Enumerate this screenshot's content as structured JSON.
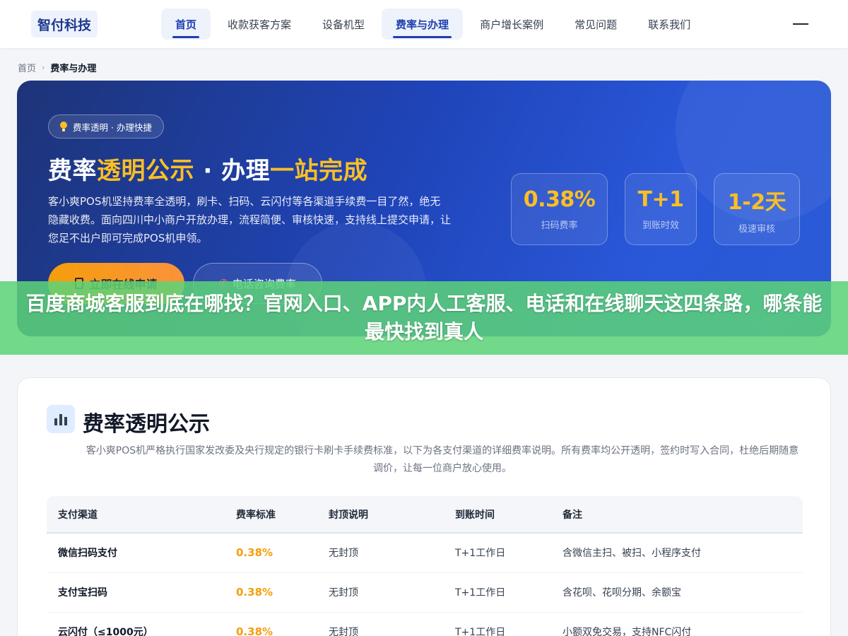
{
  "header": {
    "logo": "智付科技",
    "nav": [
      {
        "label": "首页",
        "active": true
      },
      {
        "label": "收款获客方案",
        "active": false
      },
      {
        "label": "设备机型",
        "active": false
      },
      {
        "label": "费率与办理",
        "active": true
      },
      {
        "label": "商户增长案例",
        "active": false
      },
      {
        "label": "常见问题",
        "active": false
      },
      {
        "label": "联系我们",
        "active": false
      }
    ]
  },
  "breadcrumb": {
    "home": "首页",
    "separator": "›",
    "current": "费率与办理"
  },
  "hero": {
    "badge": "费率透明 · 办理快捷",
    "title_part1": "费率",
    "title_hl1": "透明公示",
    "title_part2": " · 办理",
    "title_hl2": "一站完成",
    "description": "客小爽POS机坚持费率全透明，刷卡、扫码、云闪付等各渠道手续费一目了然，绝无隐藏收费。面向四川中小商户开放办理，流程简便、审核快速，支持线上提交申请，让您足不出户即可完成POS机申领。",
    "primary_button": "立即在线申请",
    "secondary_button": "电话咨询费率",
    "stats": [
      {
        "value": "0.38%",
        "label": "扫码费率"
      },
      {
        "value": "T+1",
        "label": "到账时效"
      },
      {
        "value": "1-2天",
        "label": "极速审核"
      }
    ]
  },
  "overlay_banner": "百度商城客服到底在哪找？官网入口、APP内人工客服、电话和在线聊天这四条路，哪条能最快找到真人",
  "section": {
    "title": "费率透明公示",
    "description": "客小爽POS机严格执行国家发改委及央行规定的银行卡刷卡手续费标准，以下为各支付渠道的详细费率说明。所有费率均公开透明，签约时写入合同，杜绝后期随意调价，让每一位商户放心使用。",
    "table": {
      "headers": [
        "支付渠道",
        "费率标准",
        "封顶说明",
        "到账时间",
        "备注"
      ],
      "rows": [
        [
          "微信扫码支付",
          "0.38%",
          "无封顶",
          "T+1工作日",
          "含微信主扫、被扫、小程序支付"
        ],
        [
          "支付宝扫码",
          "0.38%",
          "无封顶",
          "T+1工作日",
          "含花呗、花呗分期、余额宝"
        ],
        [
          "云闪付（≤1000元）",
          "0.38%",
          "无封顶",
          "T+1工作日",
          "小额双免交易，支持NFC闪付"
        ]
      ]
    }
  },
  "colors": {
    "accent_gold": "#fbbf24",
    "brand_blue": "#1e40af",
    "overlay_green": "#5cd378",
    "rate_orange": "#f59e0b"
  }
}
